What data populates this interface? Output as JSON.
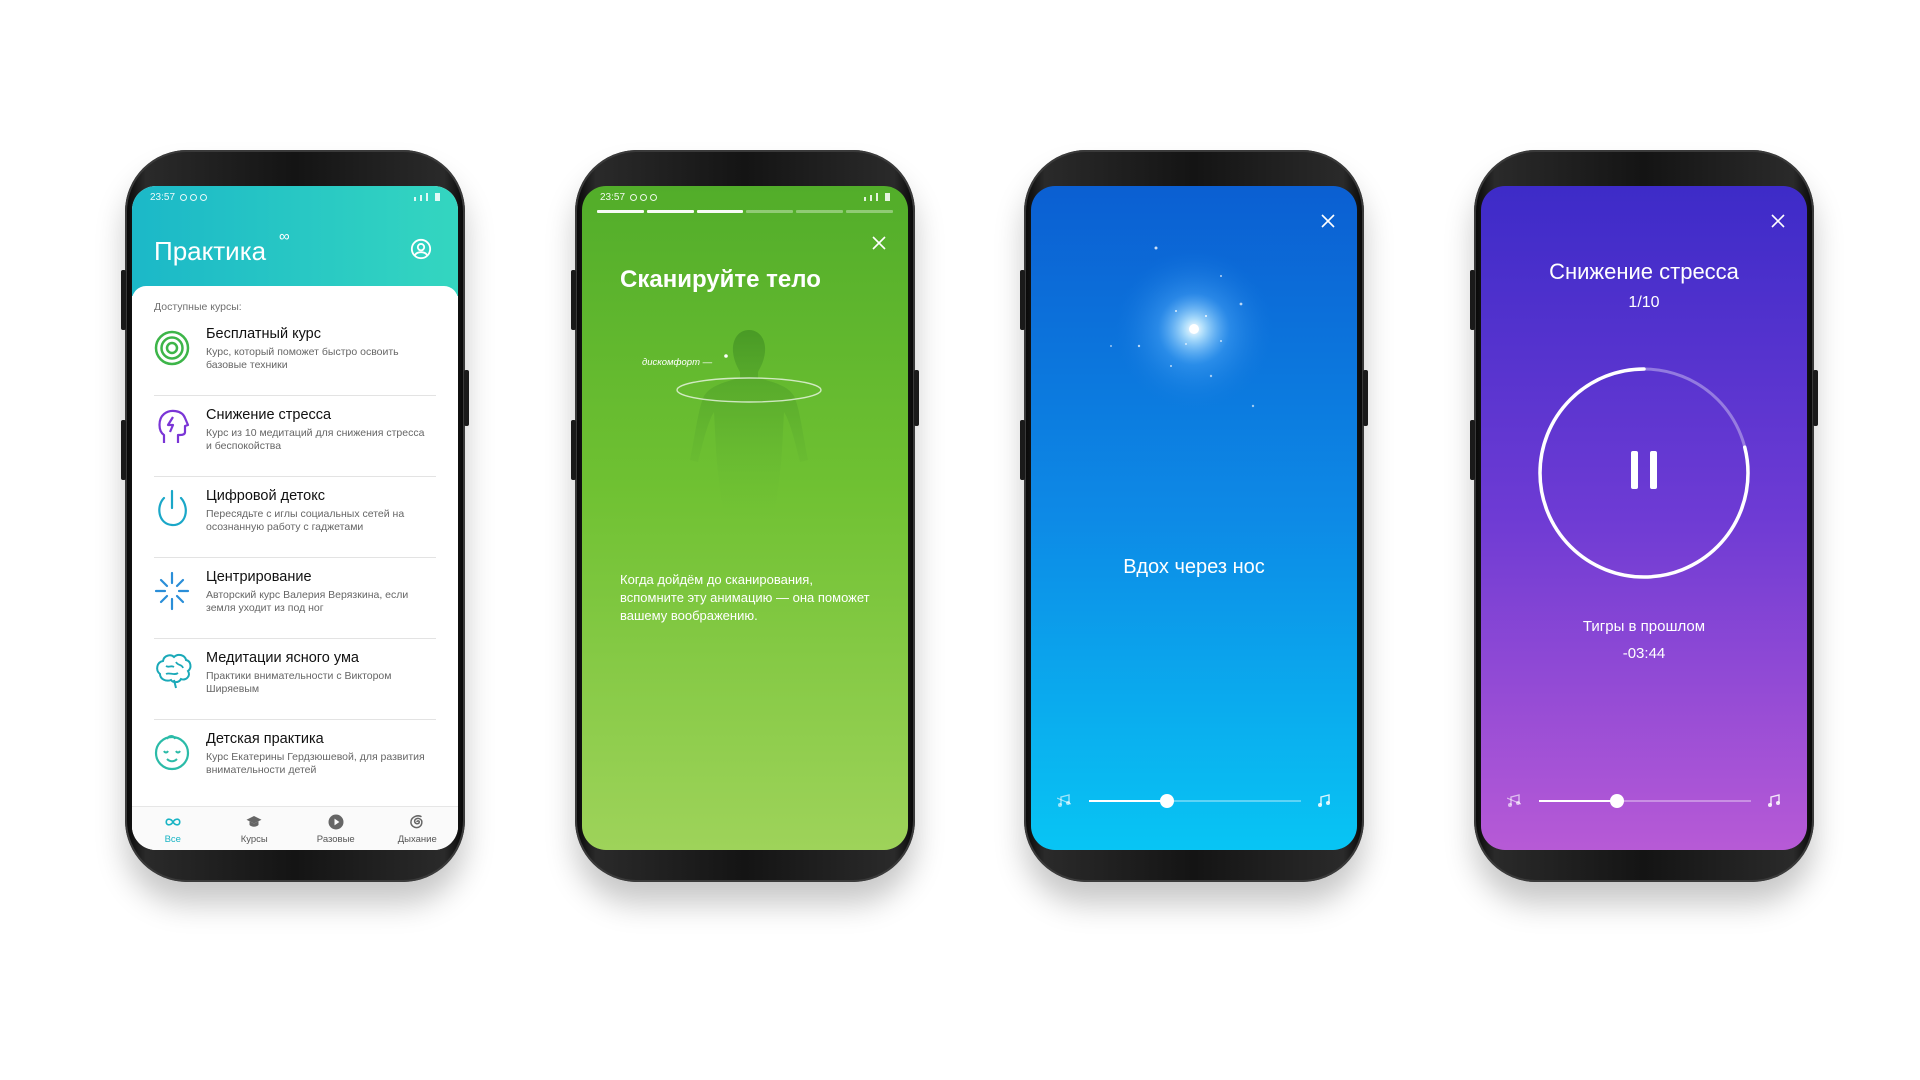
{
  "screen1": {
    "status_time": "23:57",
    "app_title": "Практика",
    "infinity_glyph": "∞",
    "section_label": "Доступные курсы:",
    "courses": [
      {
        "title": "Бесплатный курс",
        "desc": "Курс, который поможет быстро освоить базовые техники",
        "icon": "target-icon",
        "color": "#3db549"
      },
      {
        "title": "Снижение стресса",
        "desc": "Курс из 10 медитаций для снижения стресса и беспокойства",
        "icon": "head-bolt-icon",
        "color": "#7a35d6"
      },
      {
        "title": "Цифровой детокс",
        "desc": "Пересядьте с иглы социальных сетей на осознанную работу с гаджетами",
        "icon": "power-icon",
        "color": "#1aa7c8"
      },
      {
        "title": "Центрирование",
        "desc": "Авторский курс Валерия Верязкина, если земля уходит из под ног",
        "icon": "burst-icon",
        "color": "#2a8ed8"
      },
      {
        "title": "Медитации ясного ума",
        "desc": "Практики внимательности с Виктором Ширяевым",
        "icon": "brain-icon",
        "color": "#1aa9b8"
      },
      {
        "title": "Детская практика",
        "desc": "Курс Екатерины Гердзюшевой, для развития внимательности детей",
        "icon": "baby-face-icon",
        "color": "#2bbba8"
      }
    ],
    "tabs": [
      {
        "label": "Все",
        "icon": "infinity-icon",
        "active": true
      },
      {
        "label": "Курсы",
        "icon": "graduation-cap-icon",
        "active": false
      },
      {
        "label": "Разовые",
        "icon": "play-circle-icon",
        "active": false
      },
      {
        "label": "Дыхание",
        "icon": "spiral-icon",
        "active": false
      }
    ],
    "accent": "#19b4c4"
  },
  "screen2": {
    "status_time": "23:57",
    "progress": {
      "segments": 6,
      "completed": 3
    },
    "title": "Сканируйте тело",
    "figure_label": "дискомфорт —",
    "body": "Когда дойдём до сканирования, вспомните эту анимацию — она поможет вашему воображению."
  },
  "screen3": {
    "instruction": "Вдох через нос",
    "volume": 0.37
  },
  "screen4": {
    "title": "Снижение стресса",
    "counter": "1/10",
    "track_name": "Тигры в прошлом",
    "remaining": "-03:44",
    "playback_progress": 0.21,
    "volume": 0.37
  }
}
